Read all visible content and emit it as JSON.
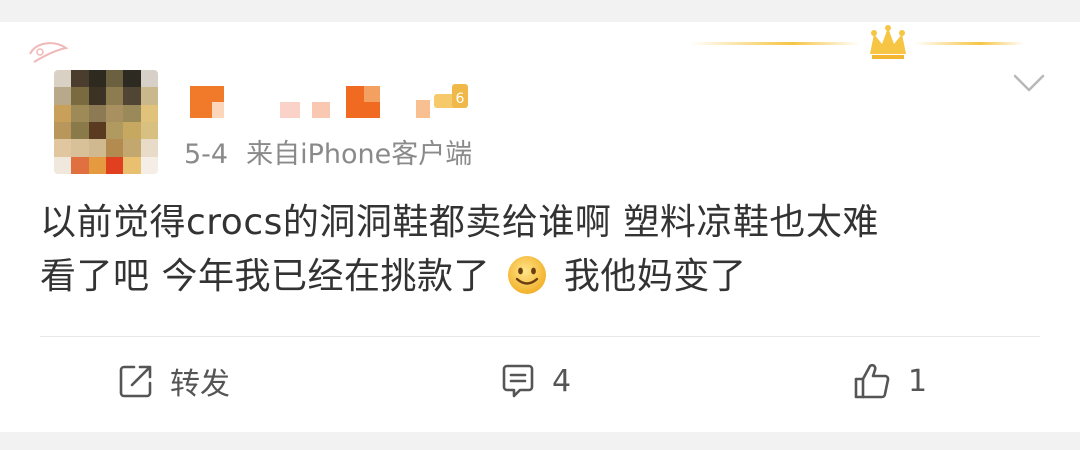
{
  "post": {
    "date": "5-4",
    "source": "来自iPhone客户端",
    "text_line1": "以前觉得crocs的洞洞鞋都卖给谁啊 塑料凉鞋也太难",
    "text_line2a": "看了吧 今年我已经在挑款了",
    "text_line2b": "我他妈变了",
    "level_badge": "6"
  },
  "actions": {
    "repost_label": "转发",
    "comment_count": "4",
    "like_count": "1"
  },
  "icons": {
    "crown": "crown-icon",
    "chevron": "chevron-down-icon",
    "repost": "repost-icon",
    "comment": "comment-icon",
    "like": "thumbs-up-icon",
    "emoji": "smile-emoji-icon"
  },
  "colors": {
    "gold": "#f6c544",
    "meta_gray": "#8a8a8a",
    "text": "#333333"
  }
}
